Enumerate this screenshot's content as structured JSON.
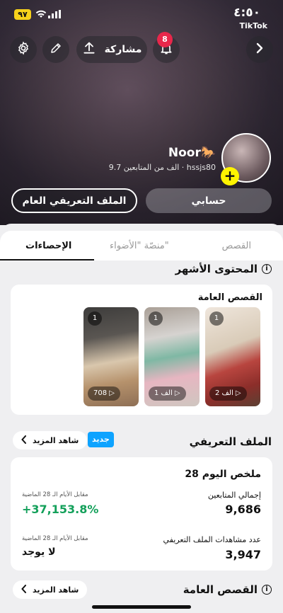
{
  "status_bar": {
    "time": "٤:٥٠",
    "battery": "٩٧",
    "return_app": "TikTok"
  },
  "header": {
    "share_label": "مشاركة",
    "notification_count": "8",
    "icons": [
      "settings-icon",
      "edit-icon",
      "share-icon",
      "bell-icon",
      "chevron-right-icon"
    ]
  },
  "profile": {
    "name": "Noor🐎",
    "username": "hssjs80",
    "followers_text": "9.7 الف من المتابعين",
    "add_label": "+"
  },
  "actions": {
    "account_label": "حسابي",
    "public_profile_label": "الملف التعريفي العام"
  },
  "tabs": [
    {
      "label": "القصص"
    },
    {
      "label": "منصّة \"الأضواء\""
    },
    {
      "label": "الإحصاءات"
    }
  ],
  "top_content": {
    "title": "المحتوى الأشهر",
    "card_title": "القصص العامة",
    "stories": [
      {
        "count": "1",
        "views": "2 الف"
      },
      {
        "count": "1",
        "views": "1 الف"
      },
      {
        "count": "1",
        "views": "708"
      }
    ]
  },
  "profile_section": {
    "title": "الملف التعريفي",
    "new_badge": "جديد",
    "see_more": "شاهد المزيد",
    "summary_title": "28 ملخص اليوم",
    "followers_label": "إجمالي المتابعين",
    "followers_value": "9,686",
    "followers_compare_label": "مقابل الأيام الـ 28 الماضية",
    "followers_compare_value": "+37,153.8%",
    "views_label": "عدد مشاهدات الملف التعريفي",
    "views_value": "3,947",
    "views_compare_label": "مقابل الأيام الـ 28 الماضية",
    "views_compare_value": "لا يوجد"
  },
  "public_stories_section": {
    "title": "القصص العامة",
    "see_more": "شاهد المزيد"
  },
  "colors": {
    "accent_yellow": "#fff400",
    "badge_red": "#e8274b",
    "new_blue": "#0ea3ff",
    "positive_green": "#13a05a"
  }
}
